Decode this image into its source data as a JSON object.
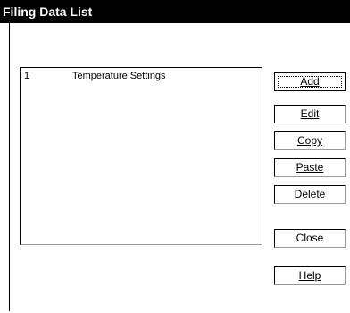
{
  "window": {
    "title": "Filing Data List"
  },
  "list": {
    "items": [
      {
        "number": "1",
        "name": "Temperature Settings"
      }
    ]
  },
  "buttons": {
    "add": "Add",
    "edit": "Edit",
    "copy": "Copy",
    "paste": "Paste",
    "delete": "Delete",
    "close": "Close",
    "help": "Help"
  }
}
